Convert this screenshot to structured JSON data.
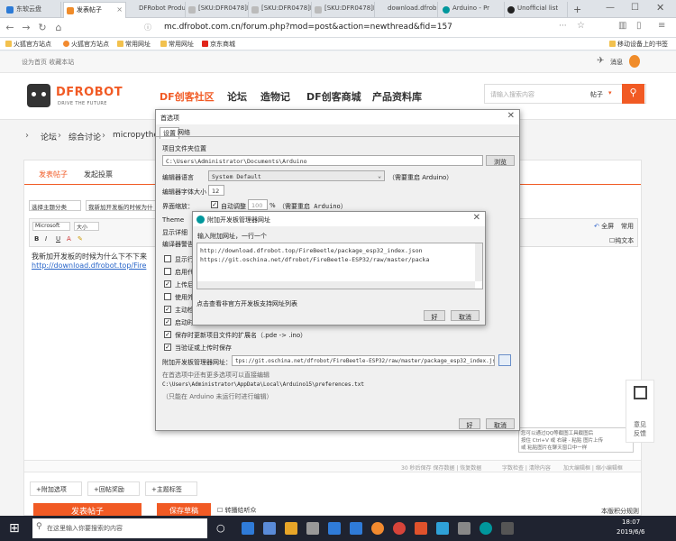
{
  "browser": {
    "tabs": [
      {
        "label": "东软云盘",
        "active": false
      },
      {
        "label": "发表帖子",
        "active": true
      },
      {
        "label": "DFRobot Produc",
        "active": false
      },
      {
        "label": "[SKU:DFR0478]F",
        "active": false
      },
      {
        "label": "[SKU:DFR0478]F",
        "active": false
      },
      {
        "label": "[SKU:DFR0478]F",
        "active": false
      },
      {
        "label": "download.dfrob",
        "active": false
      },
      {
        "label": "Arduino - Pr",
        "active": false
      },
      {
        "label": "Unofficial list",
        "active": false
      }
    ],
    "url": "mc.dfrobot.com.cn/forum.php?mod=post&action=newthread&fid=157",
    "bookmarks": [
      "火狐官方站点",
      "火狐官方站点",
      "常用网址",
      "常用网址",
      "京东商城"
    ],
    "mobile_bookmarks": "移动设备上的书签"
  },
  "site": {
    "top_left": "设为首页  收藏本站",
    "message": "消息",
    "logo_text": "DFROBOT",
    "logo_tagline": "DRIVE THE FUTURE",
    "nav": [
      "DF创客社区",
      "论坛",
      "造物记",
      "DF创客商城",
      "产品资料库"
    ],
    "search_placeholder": "请输入搜索内容",
    "search_scope": "帖子",
    "breadcrumb": [
      "论坛",
      "综合讨论",
      "micropytho"
    ],
    "post_tabs": [
      "发表帖子",
      "发起投票"
    ],
    "category_select": "选择主题分类",
    "title_input": "我新加开发板的时候为什",
    "editor_font": "Microsoft",
    "editor_size": "大小",
    "fullscreen": "全屏",
    "common": "常用",
    "plain_text": "纯文本",
    "body_text": "我新加开发板的时候为什么下不下来",
    "body_link": "http://download.dfrobot.top/Fire",
    "status_text": "30 秒后保存 保存数据 | 恢复数据",
    "word_check": "字数检查 | 清除内容",
    "edit_links": "加大编辑框 | 缩小编辑框",
    "bottom_buttons": [
      "附加选项",
      "回帖奖励",
      "主题标签"
    ],
    "publish": "发表帖子",
    "save_draft": "保存草稿",
    "convert_checkbox": "转播给听众",
    "rules": "本版积分规则",
    "side_panel": [
      "意见",
      "反馈"
    ],
    "tip_lines": [
      "您可以通过QQ等截图工具截图后",
      "按住 Ctrl+V 或 右键 - 粘贴 图片上传",
      "或 粘贴图片在聊天窗口中一样"
    ]
  },
  "prefs_dialog": {
    "title": "首选项",
    "tabs": [
      "设置",
      "网络"
    ],
    "sketchbook_label": "项目文件夹位置",
    "sketchbook_path": "C:\\Users\\Administrator\\Documents\\Arduino",
    "browse": "浏览",
    "language_label": "编辑器语言",
    "language_value": "System Default",
    "language_note": "（需要重启 Arduino）",
    "font_size_label": "编辑器字体大小",
    "font_size_value": "12",
    "scale_label": "界面缩放：",
    "auto_adjust": "自动调整",
    "scale_value": "100",
    "scale_unit": "%",
    "scale_note": "（需要重启 Arduino）",
    "theme_label": "Theme",
    "verbose_label": "显示详细",
    "warnings_label": "编译器警告",
    "options": [
      {
        "label": "显示行",
        "checked": false
      },
      {
        "label": "启用代",
        "checked": false
      },
      {
        "label": "上传后",
        "checked": true
      },
      {
        "label": "使用外",
        "checked": false
      },
      {
        "label": "主动检",
        "checked": true
      },
      {
        "label": "启动时",
        "checked": true
      },
      {
        "label": "保存时更新项目文件的扩展名（.pde -> .ino）",
        "checked": true
      },
      {
        "label": "当验证或上传时保存",
        "checked": true
      }
    ],
    "boards_url_label": "附加开发板管理器网址：",
    "boards_url_value": "tps://git.oschina.net/dfrobot/FireBeetle-ESP32/raw/master/package_esp32_index.json",
    "more_prefs": "在首选项中还有更多选项可以直接编辑",
    "prefs_path": "C:\\Users\\Administrator\\AppData\\Local\\Arduino15\\preferences.txt",
    "edit_note": "（只能在 Arduino 未运行时进行编辑）",
    "ok": "好",
    "cancel": "取消"
  },
  "urls_dialog": {
    "title": "附加开发板管理器网址",
    "prompt": "输入附加网址，一行一个",
    "lines": [
      "http://download.dfrobot.top/FireBeetle/package_esp32_index.json",
      "https://git.oschina.net/dfrobot/FireBeetle-ESP32/raw/master/packa"
    ],
    "link": "点击查看非官方开发板支持网址列表",
    "ok": "好",
    "cancel": "取消"
  },
  "taskbar": {
    "search_placeholder": "在这里输入你要搜索的内容",
    "time": "18:07",
    "date": "2019/6/6"
  },
  "colors": {
    "brand_orange": "#f15a24",
    "taskbar": "#1f2330",
    "arduino_teal": "#00979c"
  }
}
